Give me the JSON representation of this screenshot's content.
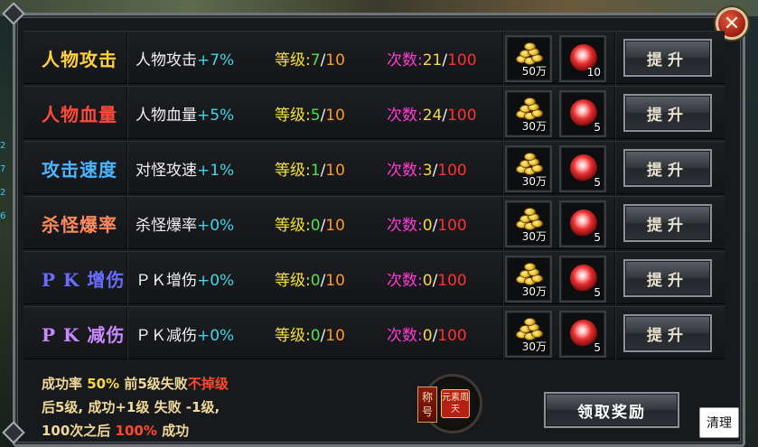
{
  "window": {
    "close_label": "✕",
    "claim_label": "领取奖励",
    "clean_label": "清理"
  },
  "side_numbers": [
    "2",
    "7",
    "2",
    "6"
  ],
  "rows": [
    {
      "title": "人物攻击",
      "title_color": "#ffd23c",
      "desc_name": "人物攻击",
      "desc_pct": "+7%",
      "level_label": "等级:",
      "level_cur": "7",
      "level_max": "10",
      "count_label": "次数:",
      "count_cur": "21",
      "count_max": "100",
      "coin_label": "50万",
      "gem_label": "10",
      "button_label": "提升"
    },
    {
      "title": "人物血量",
      "title_color": "#ff4a3a",
      "desc_name": "人物血量",
      "desc_pct": "+5%",
      "level_label": "等级:",
      "level_cur": "5",
      "level_max": "10",
      "count_label": "次数:",
      "count_cur": "24",
      "count_max": "100",
      "coin_label": "30万",
      "gem_label": "5",
      "button_label": "提升"
    },
    {
      "title": "攻击速度",
      "title_color": "#49b6ff",
      "desc_name": "对怪攻速",
      "desc_pct": "+1%",
      "level_label": "等级:",
      "level_cur": "1",
      "level_max": "10",
      "count_label": "次数:",
      "count_cur": "3",
      "count_max": "100",
      "coin_label": "30万",
      "gem_label": "5",
      "button_label": "提升"
    },
    {
      "title": "杀怪爆率",
      "title_color": "#ff8a5c",
      "desc_name": "杀怪爆率",
      "desc_pct": "+0%",
      "level_label": "等级:",
      "level_cur": "0",
      "level_max": "10",
      "count_label": "次数:",
      "count_cur": "0",
      "count_max": "100",
      "coin_label": "30万",
      "gem_label": "5",
      "button_label": "提升"
    },
    {
      "title": "P K 增伤",
      "title_color": "#6a6cff",
      "desc_name": "ＰＫ增伤",
      "desc_pct": "+0%",
      "level_label": "等级:",
      "level_cur": "0",
      "level_max": "10",
      "count_label": "次数:",
      "count_cur": "0",
      "count_max": "100",
      "coin_label": "30万",
      "gem_label": "5",
      "button_label": "提升"
    },
    {
      "title": "P K 减伤",
      "title_color": "#c88aff",
      "desc_name": "ＰＫ减伤",
      "desc_pct": "+0%",
      "level_label": "等级:",
      "level_cur": "0",
      "level_max": "10",
      "count_label": "次数:",
      "count_cur": "0",
      "count_max": "100",
      "coin_label": "30万",
      "gem_label": "5",
      "button_label": "提升"
    }
  ],
  "rules": {
    "line1_a": "成功率 ",
    "line1_rate": "50%",
    "line1_b": "  前5级失败",
    "line1_hl": "不掉级",
    "line2": "后5级, 成功+1级 失败 -1级,",
    "line3_a": "100次之后 ",
    "line3_hl": "100%",
    "line3_b": " 成功"
  },
  "badge": {
    "tag": "称号",
    "seal": "元素周天"
  }
}
